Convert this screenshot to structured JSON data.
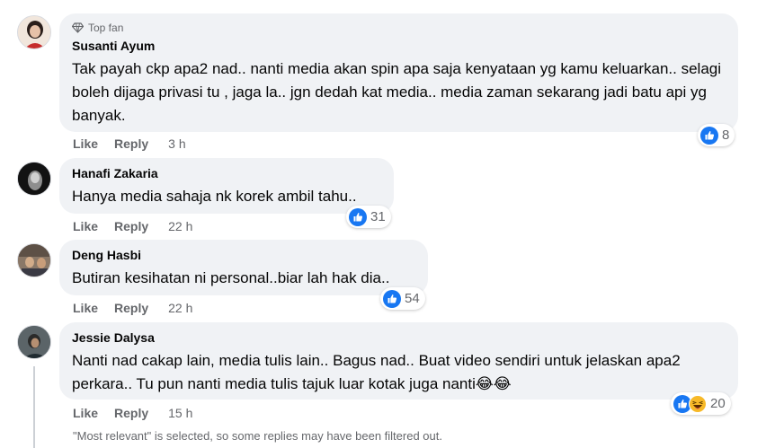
{
  "colors": {
    "like_blue": "#1877f2",
    "bubble_bg": "#f0f2f5",
    "meta_gray": "#65676b",
    "haha_yellow": "#f7b928"
  },
  "comments": [
    {
      "badge": "Top fan",
      "badge_icon": "diamond-icon",
      "author": "Susanti Ayum",
      "text": "Tak payah ckp apa2 nad.. nanti media akan spin apa saja kenyataan yg kamu keluarkan.. selagi boleh dijaga privasi tu , jaga la.. jgn dedah kat media.. media zaman sekarang jadi batu api yg banyak.",
      "like_label": "Like",
      "reply_label": "Reply",
      "time": "3 h",
      "reaction_count": "8",
      "reactions": [
        "like"
      ]
    },
    {
      "author": "Hanafi Zakaria",
      "text": "Hanya media sahaja nk korek ambil tahu..",
      "like_label": "Like",
      "reply_label": "Reply",
      "time": "22 h",
      "reaction_count": "31",
      "reactions": [
        "like"
      ]
    },
    {
      "author": "Deng Hasbi",
      "text": "Butiran kesihatan ni personal..biar lah hak dia..",
      "like_label": "Like",
      "reply_label": "Reply",
      "time": "22 h",
      "reaction_count": "54",
      "reactions": [
        "like"
      ]
    },
    {
      "author": "Jessie Dalysa",
      "text": "Nanti nad cakap lain, media tulis lain.. Bagus nad.. Buat video sendiri untuk jelaskan apa2 perkara.. Tu pun nanti media tulis tajuk luar kotak juga nanti😂😂",
      "like_label": "Like",
      "reply_label": "Reply",
      "time": "15 h",
      "reaction_count": "20",
      "reactions": [
        "like",
        "haha"
      ]
    }
  ],
  "footer_note": "\"Most relevant\" is selected, so some replies may have been filtered out."
}
